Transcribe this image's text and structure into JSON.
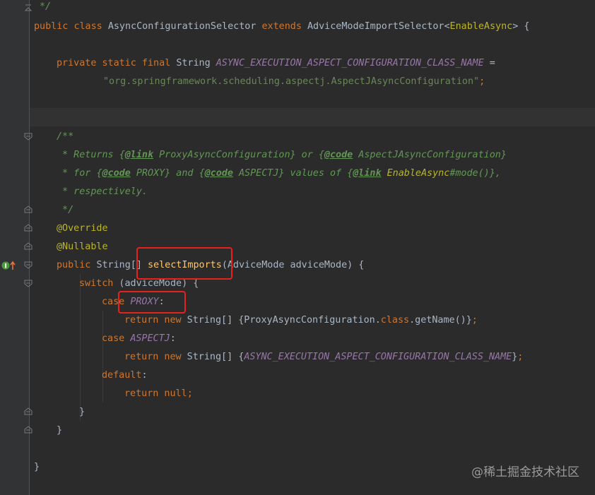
{
  "editor": {
    "lines": {
      "l1_comment_end": "*/",
      "l2_public": "public",
      "l2_class": "class",
      "l2_name": "AsyncConfigurationSelector",
      "l2_extends": "extends",
      "l2_super": "AdviceModeImportSelector",
      "l2_lt": "<",
      "l2_type": "EnableAsync",
      "l2_gt": ">",
      "l2_brace": " {",
      "l3_mods": "private static final",
      "l3_type": "String",
      "l3_const": "ASYNC_EXECUTION_ASPECT_CONFIGURATION_CLASS_NAME",
      "l3_eq": " =",
      "l4_str": "\"org.springframework.scheduling.aspectj.AspectJAsyncConfiguration\"",
      "l4_semi": ";",
      "doc1": "/**",
      "doc2_a": " * Returns ",
      "doc2_link1": "@link",
      "doc2_b": " ProxyAsyncConfiguration} or ",
      "doc2_code1": "@code",
      "doc2_c": " AspectJAsyncConfiguration}",
      "doc2_open1": "{",
      "doc2_open2": "{",
      "doc3_a": " * for ",
      "doc3_open1": "{",
      "doc3_code1": "@code",
      "doc3_b": " PROXY} and ",
      "doc3_open2": "{",
      "doc3_code2": "@code",
      "doc3_c": " ASPECTJ} values of ",
      "doc3_open3": "{",
      "doc3_link": "@link",
      "doc3_d": " ",
      "doc3_enable": "EnableAsync",
      "doc3_e": "#mode()},",
      "doc4": " * respectively.",
      "doc5": " */",
      "ann1": "@Override",
      "ann2": "@Nullable",
      "m_public": "public",
      "m_type": "String[]",
      "m_name": "selectImports",
      "m_params": "(AdviceMode adviceMode) {",
      "sw_kw": "switch",
      "sw_rest": " (adviceMode) {",
      "case1_kw": "case",
      "case1_val": "PROXY",
      "case1_colon": ":",
      "ret1_kw": "return new",
      "ret1_a": " String[] {ProxyAsyncConfiguration.",
      "ret1_class": "class",
      "ret1_b": ".getName()}",
      "ret1_semi": ";",
      "case2_kw": "case",
      "case2_val": "ASPECTJ",
      "case2_colon": ":",
      "ret2_kw": "return new",
      "ret2_a": " String[] {",
      "ret2_const": "ASYNC_EXECUTION_ASPECT_CONFIGURATION_CLASS_NAME",
      "ret2_b": "}",
      "ret2_semi": ";",
      "default_kw": "default",
      "default_colon": ":",
      "ret3_kw": "return null",
      "ret3_semi": ";",
      "close_switch": "}",
      "close_method": "}",
      "close_class": "}"
    }
  },
  "watermark": "@稀土掘金技术社区",
  "colors": {
    "background": "#2b2b2b",
    "highlight": "#e8211c",
    "keyword": "#cc7832",
    "function": "#ffc66d",
    "comment": "#629755",
    "string": "#6a8759",
    "constant": "#9876aa",
    "annotation": "#bbb529"
  },
  "icons": [
    "fold-icon",
    "implement-method-icon"
  ]
}
